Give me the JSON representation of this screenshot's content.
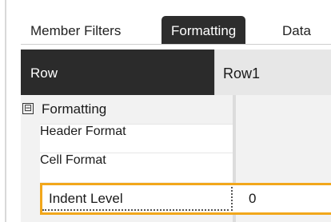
{
  "tabs": {
    "member_filters": "Member Filters",
    "formatting": "Formatting",
    "data": "Data"
  },
  "header": {
    "label": "Row",
    "value": "Row1"
  },
  "category": {
    "toggle": "⊟",
    "label": "Formatting"
  },
  "properties": {
    "header_format": "Header Format",
    "cell_format": "Cell Format",
    "indent_level": {
      "label": "Indent Level",
      "value": "0"
    }
  },
  "colors": {
    "selected_border": "#f2a71b",
    "active_tab_bg": "#2d2d2d",
    "header_bg": "#2b2b2b"
  }
}
